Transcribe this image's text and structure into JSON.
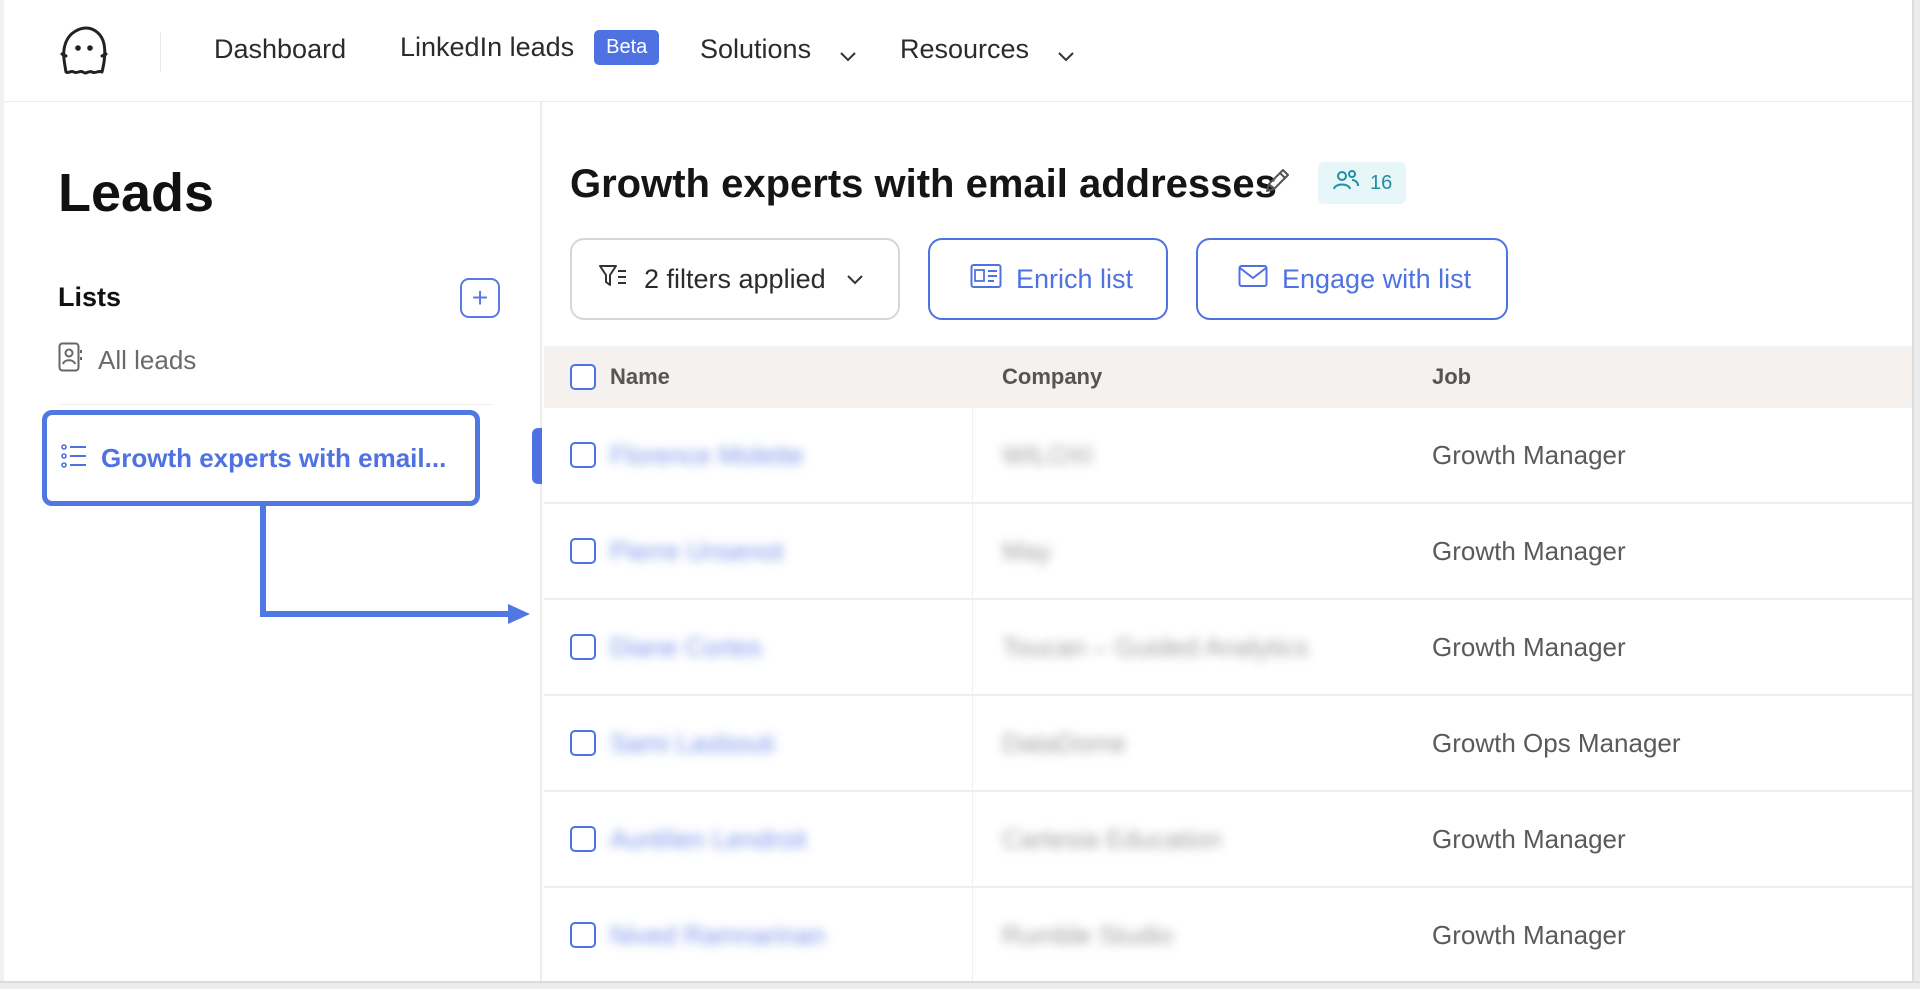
{
  "nav": {
    "items": [
      {
        "label": "Dashboard"
      },
      {
        "label": "LinkedIn leads",
        "badge": "Beta"
      },
      {
        "label": "Solutions"
      },
      {
        "label": "Resources"
      }
    ]
  },
  "sidebar": {
    "title": "Leads",
    "lists_label": "Lists",
    "add_label": "+",
    "items": [
      {
        "label": "All leads",
        "icon": "contact-card-icon"
      },
      {
        "label": "Growth experts with email...",
        "icon": "list-icon",
        "active": true
      }
    ]
  },
  "main": {
    "title": "Growth experts with email addresses",
    "lead_count": "16",
    "filter_label": "2 filters applied",
    "enrich_label": "Enrich list",
    "engage_label": "Engage with list",
    "columns": [
      "Name",
      "Company",
      "Job"
    ],
    "rows": [
      {
        "name": "Florence Molette",
        "company": "WILOXI",
        "job": "Growth Manager"
      },
      {
        "name": "Pierre Unsenot",
        "company": "May",
        "job": "Growth Manager"
      },
      {
        "name": "Diane Cortes",
        "company": "Toucan – Guided Analytics",
        "job": "Growth Manager"
      },
      {
        "name": "Sami Lasbouti",
        "company": "DataDome",
        "job": "Growth Ops Manager"
      },
      {
        "name": "Aurélien Lendroit",
        "company": "Cartesia Education",
        "job": "Growth Manager"
      },
      {
        "name": "Nived Ramnarinan",
        "company": "Rumble Studio",
        "job": "Growth Manager"
      }
    ]
  },
  "colors": {
    "accent": "#4f72e3",
    "header_bg": "#f4f1ee",
    "badge_bg": "#e6f6f9",
    "badge_text": "#1f8ea4"
  }
}
